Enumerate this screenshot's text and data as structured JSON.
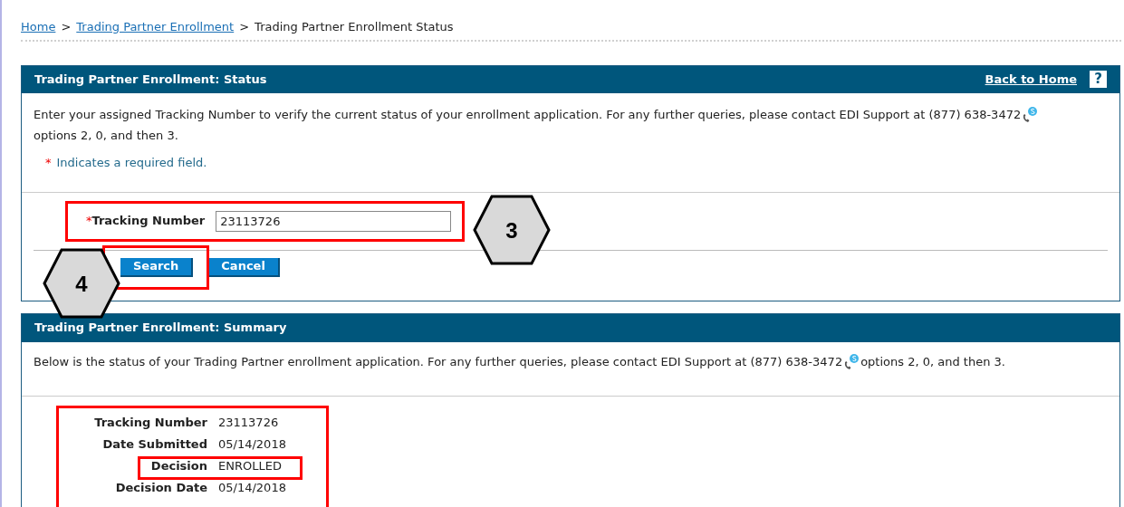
{
  "breadcrumb": [
    {
      "label": "Home",
      "kind": "link"
    },
    {
      "label": "Trading Partner Enrollment",
      "kind": "link"
    },
    {
      "label": "Trading Partner Enrollment Status",
      "kind": "current"
    }
  ],
  "breadcrumb_separator": ">",
  "status_panel": {
    "title": "Trading Partner Enrollment: Status",
    "back_link": "Back to Home",
    "help": "?",
    "intro_before": "Enter your assigned Tracking Number to verify the current status of your enrollment application. For any further queries, please contact EDI Support at (877) 638-3472",
    "intro_after": "options 2, 0, and then 3.",
    "required_mark": "*",
    "required_note": "Indicates a required field.",
    "field": {
      "label": "Tracking Number",
      "required": true,
      "value": "23113726"
    },
    "buttons": [
      "Search",
      "Cancel"
    ]
  },
  "summary_panel": {
    "title": "Trading Partner Enrollment: Summary",
    "intro_before": "Below is the status of your Trading Partner enrollment application. For any further queries, please contact EDI Support at (877) 638-3472",
    "intro_after": "options 2, 0, and then 3.",
    "rows": [
      {
        "label": "Tracking Number",
        "value": "23113726"
      },
      {
        "label": "Date Submitted",
        "value": "05/14/2018"
      },
      {
        "label": "Decision",
        "value": "ENROLLED"
      },
      {
        "label": "Decision Date",
        "value": "05/14/2018"
      }
    ]
  },
  "callouts": [
    "3",
    "4"
  ]
}
